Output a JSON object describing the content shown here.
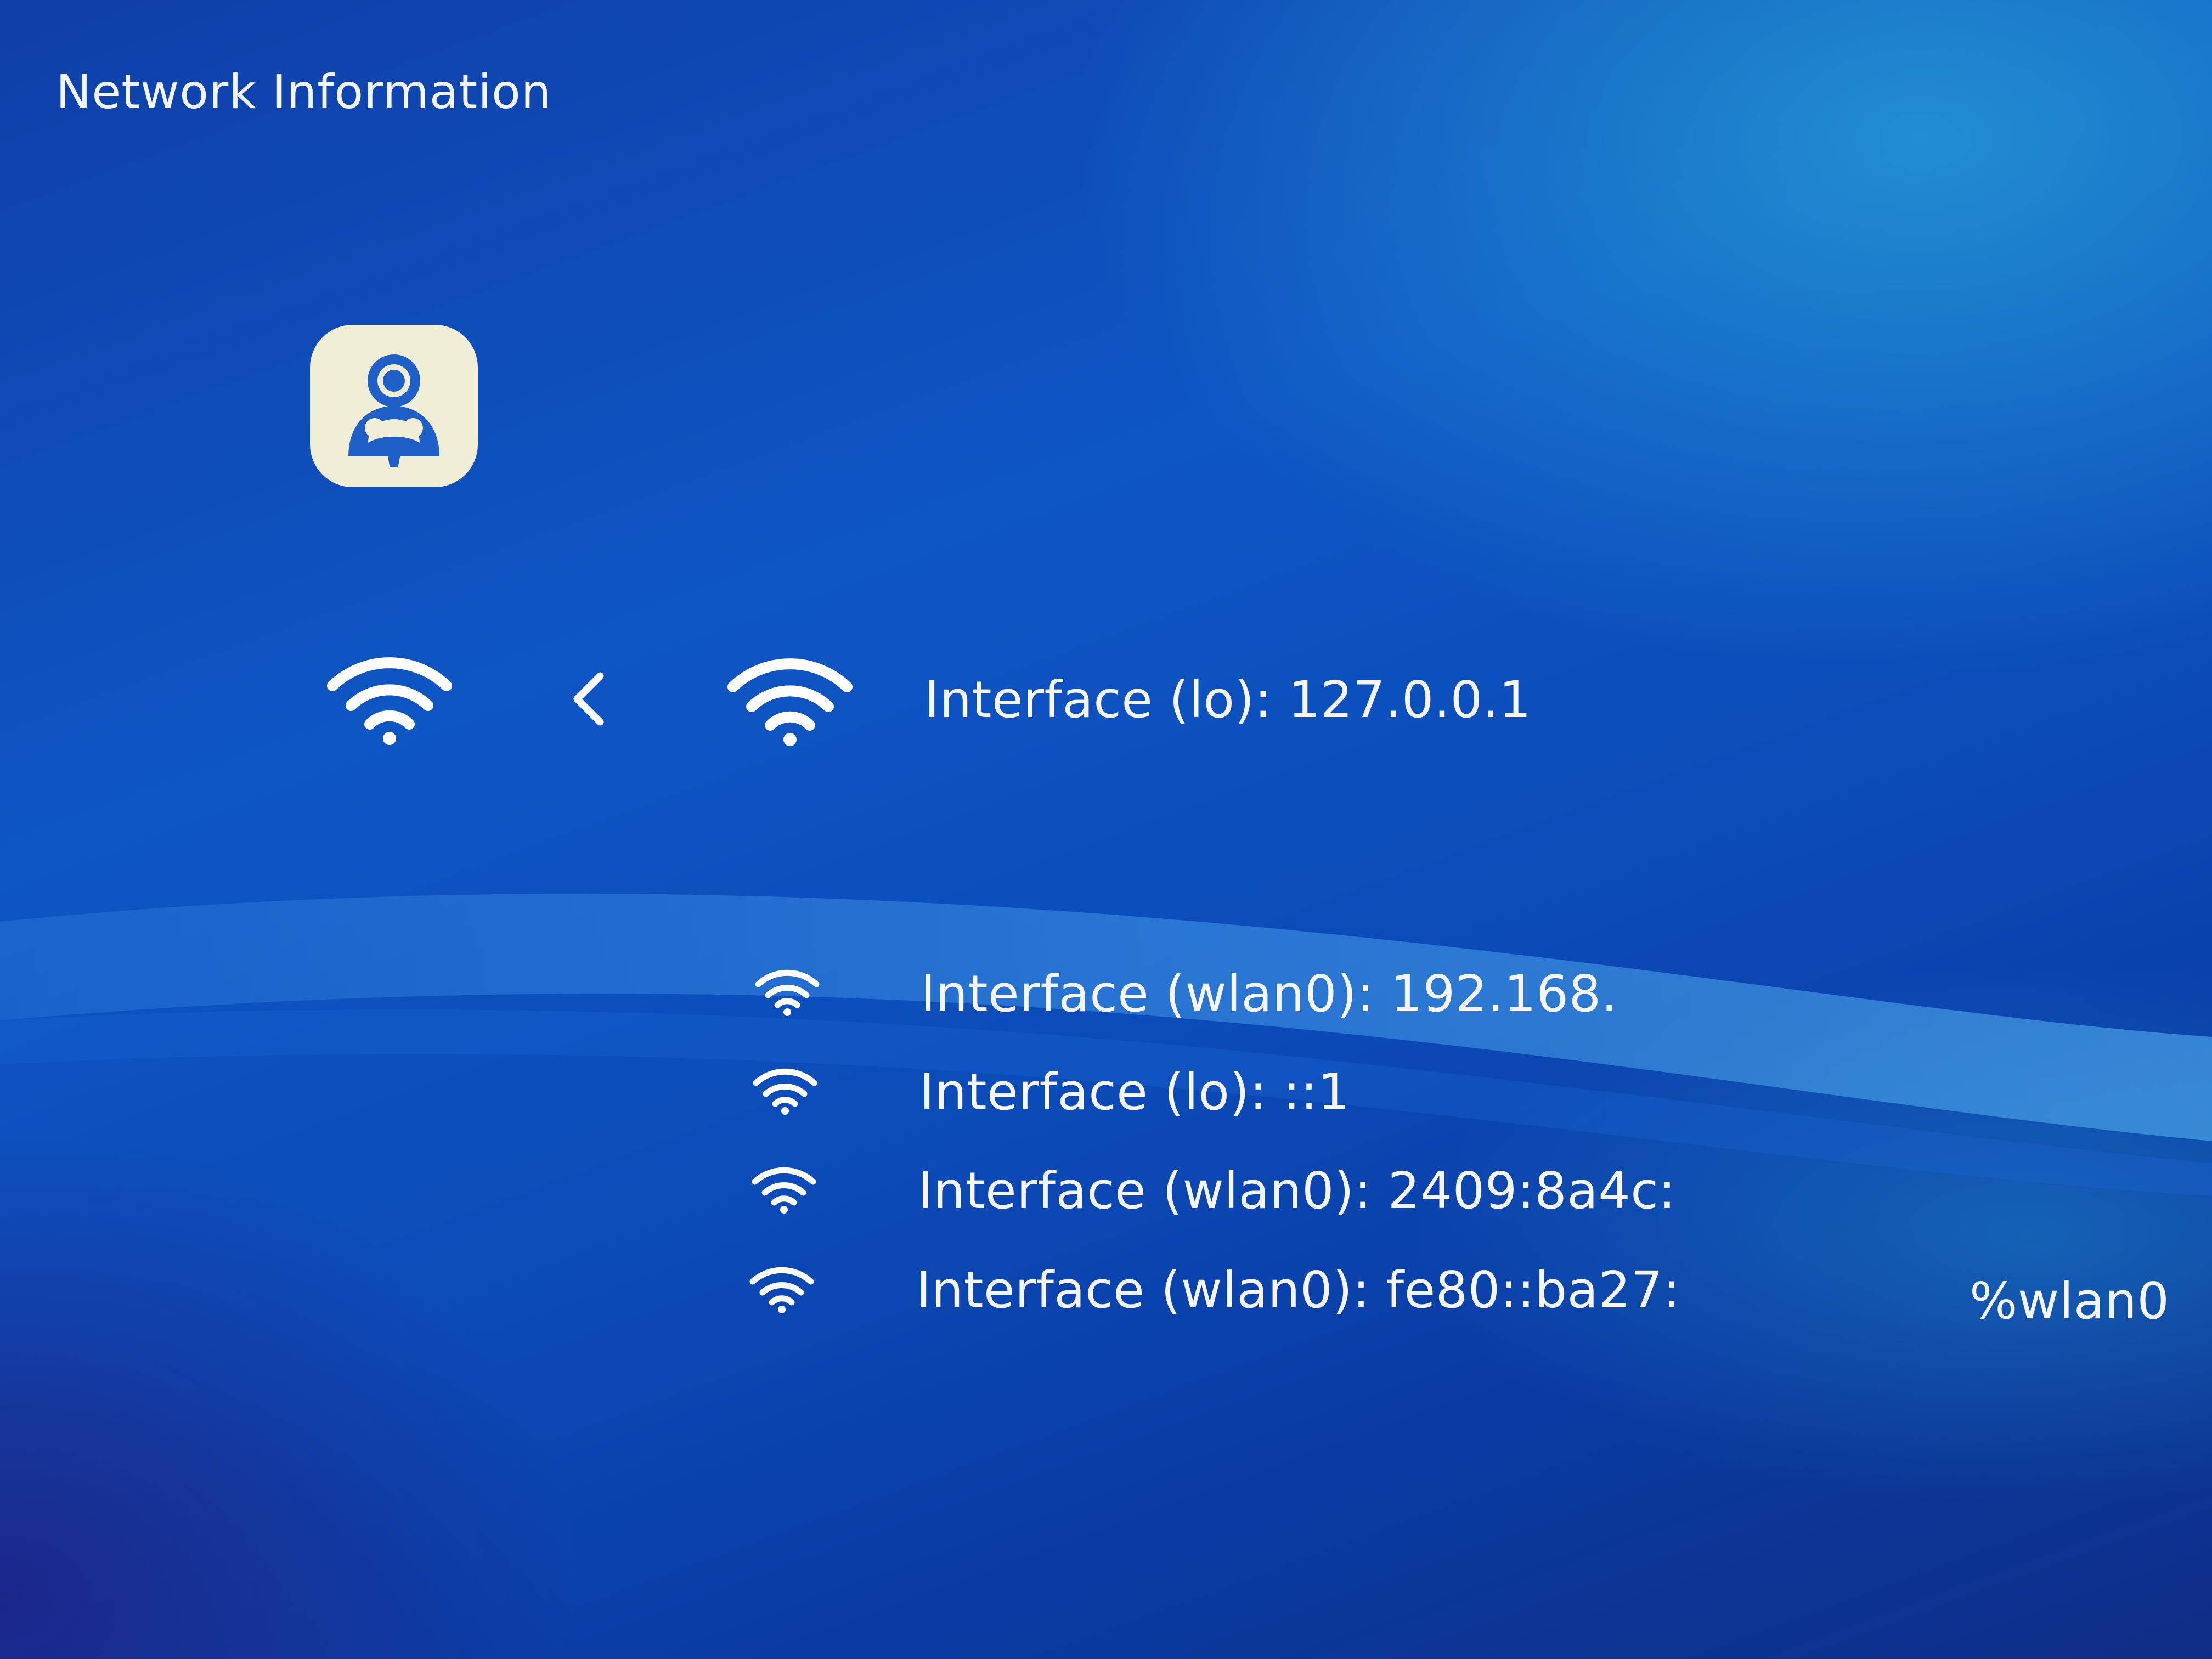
{
  "page": {
    "title": "Network Information"
  },
  "app_logo": {
    "icon": "person-avatar-icon",
    "background_color": "#f1eed8",
    "glyph_color": "#1e5fc8"
  },
  "toolbar": {
    "wifi_left_icon": "wifi-icon",
    "back_icon": "chevron-left-icon",
    "wifi_right_icon": "wifi-icon"
  },
  "primary_interface": {
    "text": "Interface (lo): 127.0.0.1"
  },
  "interfaces": [
    {
      "icon": "wifi-icon",
      "text": "Interface (wlan0): 192.168."
    },
    {
      "icon": "wifi-icon",
      "text": "Interface (lo): ::1"
    },
    {
      "icon": "wifi-icon",
      "text": "Interface (wlan0): 2409:8a4c:"
    },
    {
      "icon": "wifi-icon",
      "text": "Interface (wlan0): fe80::ba27:",
      "suffix": "%wlan0"
    }
  ],
  "colors": {
    "background_top": "#0f3fa8",
    "background_highlight": "#28a0d7",
    "text": "#f4f6fb"
  }
}
